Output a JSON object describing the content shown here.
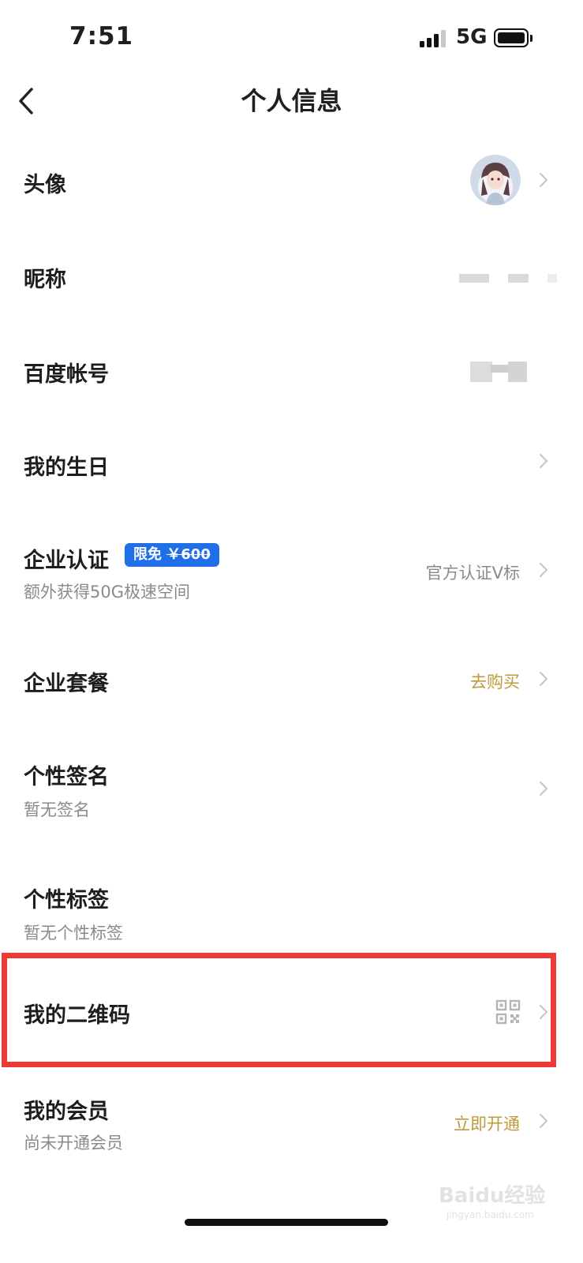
{
  "status_bar": {
    "time": "7:51",
    "network": "5G"
  },
  "nav": {
    "title": "个人信息",
    "back_icon": "chevron-left-icon"
  },
  "rows": {
    "avatar": {
      "label": "头像"
    },
    "nickname": {
      "label": "昵称"
    },
    "baidu_account": {
      "label": "百度帐号"
    },
    "birthday": {
      "label": "我的生日"
    },
    "enterprise_cert": {
      "label": "企业认证",
      "badge_prefix": "限免",
      "badge_price": "￥600",
      "subtitle": "额外获得50G极速空间",
      "value": "官方认证V标"
    },
    "enterprise_package": {
      "label": "企业套餐",
      "value": "去购买"
    },
    "signature": {
      "label": "个性签名",
      "subtitle": "暂无签名"
    },
    "tags": {
      "label": "个性标签",
      "subtitle": "暂无个性标签"
    },
    "qrcode": {
      "label": "我的二维码",
      "icon": "qr-code-icon"
    },
    "membership": {
      "label": "我的会员",
      "subtitle": "尚未开通会员",
      "value": "立即开通"
    }
  },
  "watermark": {
    "text": "Baidu经验",
    "url": "jingyan.baidu.com"
  },
  "colors": {
    "accent_blue": "#1e6fe8",
    "gold": "#c09a3a",
    "highlight_red": "#ee3a35"
  }
}
